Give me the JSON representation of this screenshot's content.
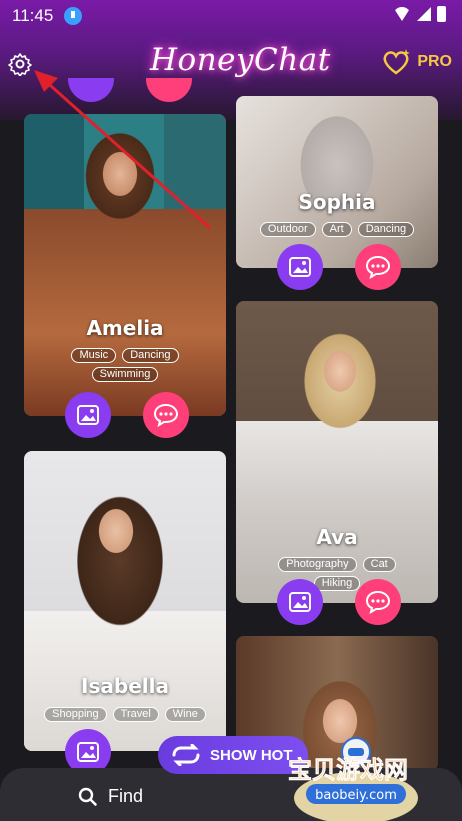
{
  "status": {
    "time": "11:45"
  },
  "header": {
    "app_title": "HoneyChat",
    "pro_label": "PRO"
  },
  "profiles": [
    {
      "name": "Amelia",
      "tags": [
        "Music",
        "Dancing",
        "Swimming"
      ]
    },
    {
      "name": "Sophia",
      "tags": [
        "Outdoor",
        "Art",
        "Dancing"
      ]
    },
    {
      "name": "Isabella",
      "tags": [
        "Shopping",
        "Travel",
        "Wine"
      ]
    },
    {
      "name": "Ava",
      "tags": [
        "Photography",
        "Cat",
        "Hiking"
      ]
    }
  ],
  "bottom": {
    "find_label": "Find",
    "show_hot_label": "SHOW HOT"
  },
  "watermark": {
    "text": "宝贝游戏网",
    "url": "baobeiy.com"
  },
  "colors": {
    "accent_purple": "#8a3df0",
    "accent_pink": "#ff3f7a",
    "pro_gold": "#f5c842"
  }
}
